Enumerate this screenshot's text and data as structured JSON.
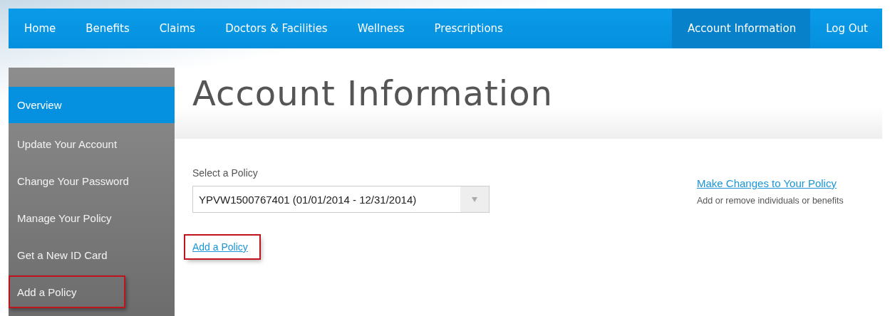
{
  "nav": {
    "items": [
      {
        "label": "Home",
        "selected": false
      },
      {
        "label": "Benefits",
        "selected": false
      },
      {
        "label": "Claims",
        "selected": false
      },
      {
        "label": "Doctors & Facilities",
        "selected": false
      },
      {
        "label": "Wellness",
        "selected": false
      },
      {
        "label": "Prescriptions",
        "selected": false
      }
    ],
    "right_items": [
      {
        "label": "Account Information",
        "selected": true
      },
      {
        "label": "Log Out",
        "selected": false
      }
    ]
  },
  "sidebar": {
    "items": [
      {
        "label": "Overview",
        "selected": true,
        "highlighted": false
      },
      {
        "label": "Update Your Account",
        "selected": false,
        "highlighted": false
      },
      {
        "label": "Change Your Password",
        "selected": false,
        "highlighted": false
      },
      {
        "label": "Manage Your Policy",
        "selected": false,
        "highlighted": false
      },
      {
        "label": "Get a New ID Card",
        "selected": false,
        "highlighted": false
      },
      {
        "label": "Add a Policy",
        "selected": false,
        "highlighted": true
      }
    ]
  },
  "page_title": "Account Information",
  "policy_select": {
    "label": "Select a Policy",
    "value": "YPVW1500767401 (01/01/2014 - 12/31/2014)"
  },
  "add_policy_link": {
    "label": "Add a Policy",
    "highlighted": true
  },
  "changes": {
    "link": "Make Changes to Your Policy",
    "description": "Add or remove individuals or benefits"
  }
}
